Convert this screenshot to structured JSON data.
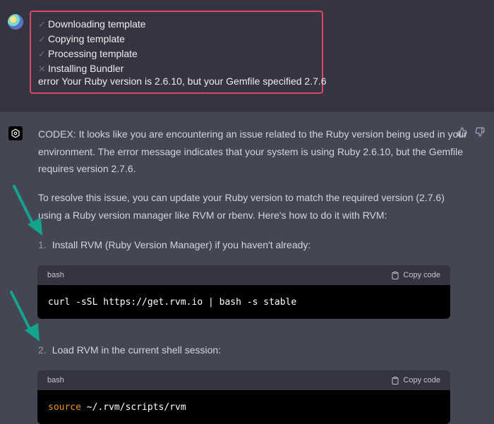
{
  "user_message": {
    "status_steps": [
      {
        "mark": "✓",
        "icon": "check-icon",
        "text": "Downloading template"
      },
      {
        "mark": "✓",
        "icon": "check-icon",
        "text": "Copying template"
      },
      {
        "mark": "✓",
        "icon": "check-icon",
        "text": "Processing template"
      },
      {
        "mark": "✕",
        "icon": "x-icon",
        "text": "Installing Bundler"
      }
    ],
    "error": "error Your Ruby version is 2.6.10, but your Gemfile specified 2.7.6"
  },
  "assistant": {
    "para1_lines": [
      "CODEX: It looks like you are encountering an issue related to the Ruby version being used in your",
      "environment. The error message indicates that your system is using Ruby 2.6.10, but the Gemfile",
      "requires version 2.7.6."
    ],
    "para2_lines": [
      "To resolve this issue, you can update your Ruby version to match the required version (2.7.6)",
      "using a Ruby version manager like RVM or rbenv. Here's how to do it with RVM:"
    ],
    "steps": [
      {
        "num": "1.",
        "text": "Install RVM (Ruby Version Manager) if you haven't already:",
        "code_lang": "bash",
        "copy_label": "Copy code",
        "code_keyword": "",
        "code_rest": "curl -sSL https://get.rvm.io | bash -s stable"
      },
      {
        "num": "2.",
        "text": "Load RVM in the current shell session:",
        "code_lang": "bash",
        "copy_label": "Copy code",
        "code_keyword": "source",
        "code_rest": " ~/.rvm/scripts/rvm"
      }
    ]
  },
  "colors": {
    "highlight_border": "#e0446a",
    "arrow": "#14a38b",
    "keyword": "#e9950c"
  }
}
